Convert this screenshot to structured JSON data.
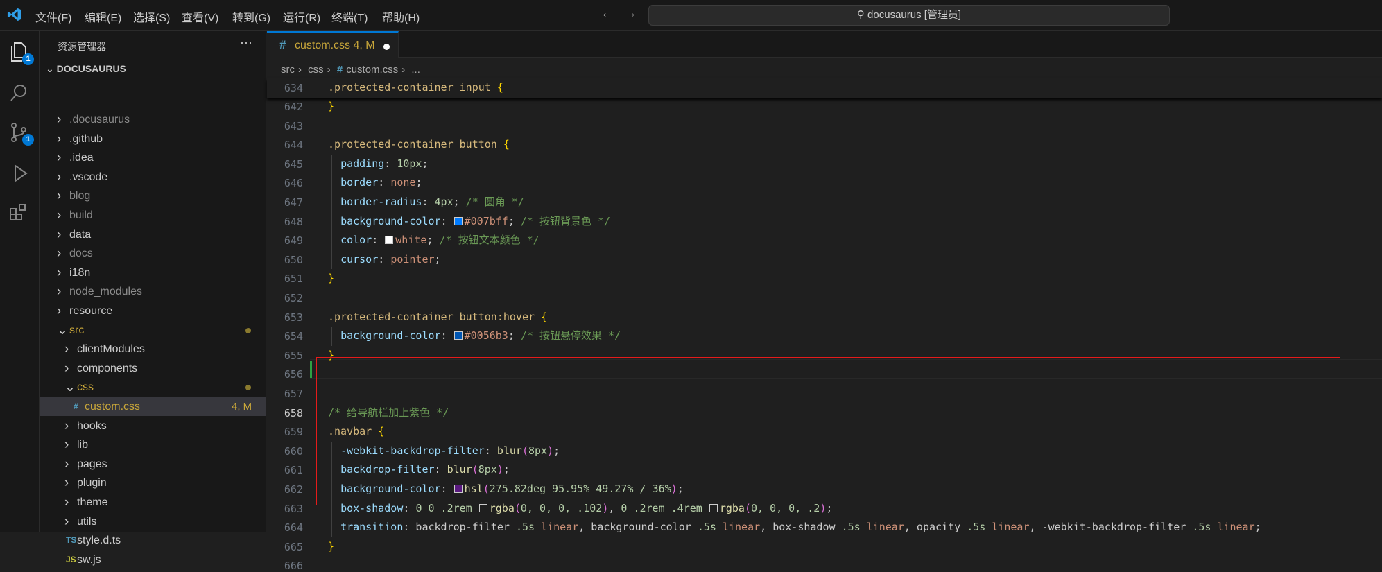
{
  "menu": [
    "文件(F)",
    "编辑(E)",
    "选择(S)",
    "查看(V)",
    "转到(G)",
    "运行(R)",
    "终端(T)",
    "帮助(H)"
  ],
  "command_center": "docusaurus [管理员]",
  "activity": {
    "explorer_badge": "1",
    "scm_badge": "1"
  },
  "sidebar": {
    "title": "资源管理器",
    "more": "···",
    "root": "DOCUSAURUS",
    "items": [
      {
        "label": ".docusaurus",
        "type": "folder",
        "depth": 0,
        "dim": true
      },
      {
        "label": ".github",
        "type": "folder",
        "depth": 0
      },
      {
        "label": ".idea",
        "type": "folder",
        "depth": 0
      },
      {
        "label": ".vscode",
        "type": "folder",
        "depth": 0
      },
      {
        "label": "blog",
        "type": "folder",
        "depth": 0,
        "dim": true
      },
      {
        "label": "build",
        "type": "folder",
        "depth": 0,
        "dim": true
      },
      {
        "label": "data",
        "type": "folder",
        "depth": 0
      },
      {
        "label": "docs",
        "type": "folder",
        "depth": 0,
        "dim": true
      },
      {
        "label": "i18n",
        "type": "folder",
        "depth": 0
      },
      {
        "label": "node_modules",
        "type": "folder",
        "depth": 0,
        "dim": true
      },
      {
        "label": "resource",
        "type": "folder",
        "depth": 0
      },
      {
        "label": "src",
        "type": "folder",
        "depth": 0,
        "open": true,
        "modified": true
      },
      {
        "label": "clientModules",
        "type": "folder",
        "depth": 1
      },
      {
        "label": "components",
        "type": "folder",
        "depth": 1
      },
      {
        "label": "css",
        "type": "folder",
        "depth": 1,
        "open": true,
        "modified": true
      },
      {
        "label": "custom.css",
        "type": "css",
        "depth": 2,
        "modified": true,
        "status": "4, M",
        "selected": true
      },
      {
        "label": "hooks",
        "type": "folder",
        "depth": 1
      },
      {
        "label": "lib",
        "type": "folder",
        "depth": 1
      },
      {
        "label": "pages",
        "type": "folder",
        "depth": 1
      },
      {
        "label": "plugin",
        "type": "folder",
        "depth": 1
      },
      {
        "label": "theme",
        "type": "folder",
        "depth": 1
      },
      {
        "label": "utils",
        "type": "folder",
        "depth": 1
      },
      {
        "label": "style.d.ts",
        "type": "ts",
        "depth": 1
      },
      {
        "label": "sw.js",
        "type": "js",
        "depth": 1
      }
    ]
  },
  "tab": {
    "name": "custom.css",
    "status": "4, M"
  },
  "breadcrumb": [
    "src",
    "css",
    "custom.css",
    "..."
  ],
  "colors": {
    "accent": "#0078d4",
    "highlight_box": "#e51b1b",
    "modified": "#c9a73a"
  },
  "sticky": {
    "num": "634",
    "tokens": [
      [
        ".protected-container input ",
        "s"
      ],
      [
        "{",
        "b"
      ]
    ]
  },
  "lines": [
    {
      "num": "642",
      "tokens": [
        [
          "}",
          "b"
        ]
      ]
    },
    {
      "num": "643",
      "tokens": []
    },
    {
      "num": "644",
      "tokens": [
        [
          ".protected-container button ",
          "s"
        ],
        [
          "{",
          "b"
        ]
      ]
    },
    {
      "num": "645",
      "tokens": [
        [
          "  ",
          "t"
        ],
        [
          "padding",
          "p"
        ],
        [
          ": ",
          "t"
        ],
        [
          "10px",
          "n"
        ],
        [
          ";",
          "t"
        ]
      ]
    },
    {
      "num": "646",
      "tokens": [
        [
          "  ",
          "t"
        ],
        [
          "border",
          "p"
        ],
        [
          ": ",
          "t"
        ],
        [
          "none",
          "v"
        ],
        [
          ";",
          "t"
        ]
      ]
    },
    {
      "num": "647",
      "tokens": [
        [
          "  ",
          "t"
        ],
        [
          "border-radius",
          "p"
        ],
        [
          ": ",
          "t"
        ],
        [
          "4px",
          "n"
        ],
        [
          "; ",
          "t"
        ],
        [
          "/* 圆角 */",
          "c"
        ]
      ]
    },
    {
      "num": "648",
      "tokens": [
        [
          "  ",
          "t"
        ],
        [
          "background-color",
          "p"
        ],
        [
          ": ",
          "t"
        ],
        [
          "#007bff",
          "sw"
        ],
        [
          "#007bff",
          "v"
        ],
        [
          "; ",
          "t"
        ],
        [
          "/* 按钮背景色 */",
          "c"
        ]
      ]
    },
    {
      "num": "649",
      "tokens": [
        [
          "  ",
          "t"
        ],
        [
          "color",
          "p"
        ],
        [
          ": ",
          "t"
        ],
        [
          "#ffffff",
          "sw"
        ],
        [
          "white",
          "v"
        ],
        [
          "; ",
          "t"
        ],
        [
          "/* 按钮文本颜色 */",
          "c"
        ]
      ]
    },
    {
      "num": "650",
      "tokens": [
        [
          "  ",
          "t"
        ],
        [
          "cursor",
          "p"
        ],
        [
          ": ",
          "t"
        ],
        [
          "pointer",
          "v"
        ],
        [
          ";",
          "t"
        ]
      ]
    },
    {
      "num": "651",
      "tokens": [
        [
          "}",
          "b"
        ]
      ]
    },
    {
      "num": "652",
      "tokens": []
    },
    {
      "num": "653",
      "tokens": [
        [
          ".protected-container button:hover ",
          "s"
        ],
        [
          "{",
          "b"
        ]
      ]
    },
    {
      "num": "654",
      "tokens": [
        [
          "  ",
          "t"
        ],
        [
          "background-color",
          "p"
        ],
        [
          ": ",
          "t"
        ],
        [
          "#0056b3",
          "sw"
        ],
        [
          "#0056b3",
          "v"
        ],
        [
          "; ",
          "t"
        ],
        [
          "/* 按钮悬停效果 */",
          "c"
        ]
      ]
    },
    {
      "num": "655",
      "tokens": [
        [
          "}",
          "b"
        ]
      ]
    },
    {
      "num": "656",
      "tokens": []
    },
    {
      "num": "657",
      "tokens": []
    },
    {
      "num": "658",
      "tokens": [
        [
          "/* 给导航栏加上紫色 */",
          "c"
        ]
      ]
    },
    {
      "num": "659",
      "tokens": [
        [
          ".navbar ",
          "s"
        ],
        [
          "{",
          "b"
        ]
      ]
    },
    {
      "num": "660",
      "tokens": [
        [
          "  ",
          "t"
        ],
        [
          "-webkit-backdrop-filter",
          "p"
        ],
        [
          ": ",
          "t"
        ],
        [
          "blur",
          "f"
        ],
        [
          "(",
          "q"
        ],
        [
          "8px",
          "n"
        ],
        [
          ")",
          "q"
        ],
        [
          ";",
          "t"
        ]
      ]
    },
    {
      "num": "661",
      "tokens": [
        [
          "  ",
          "t"
        ],
        [
          "backdrop-filter",
          "p"
        ],
        [
          ": ",
          "t"
        ],
        [
          "blur",
          "f"
        ],
        [
          "(",
          "q"
        ],
        [
          "8px",
          "n"
        ],
        [
          ")",
          "q"
        ],
        [
          ";",
          "t"
        ]
      ]
    },
    {
      "num": "662",
      "tokens": [
        [
          "  ",
          "t"
        ],
        [
          "background-color",
          "p"
        ],
        [
          ": ",
          "t"
        ],
        [
          "#5a1a80",
          "sw"
        ],
        [
          "hsl",
          "f"
        ],
        [
          "(",
          "q"
        ],
        [
          "275.82deg 95.95% 49.27% / 36%",
          "n"
        ],
        [
          ")",
          "q"
        ],
        [
          ";",
          "t"
        ]
      ]
    },
    {
      "num": "663",
      "tokens": [
        [
          "  ",
          "t"
        ],
        [
          "box-shadow",
          "p"
        ],
        [
          ": ",
          "t"
        ],
        [
          "0 0 .2rem ",
          "n"
        ],
        [
          "#1f1f1f",
          "sw"
        ],
        [
          "rgba",
          "f"
        ],
        [
          "(",
          "q"
        ],
        [
          "0, 0, 0, .102",
          "n"
        ],
        [
          ")",
          "q"
        ],
        [
          ", ",
          "t"
        ],
        [
          "0 .2rem .4rem ",
          "n"
        ],
        [
          "#1f1f1f",
          "sw"
        ],
        [
          "rgba",
          "f"
        ],
        [
          "(",
          "q"
        ],
        [
          "0, 0, 0, .2",
          "n"
        ],
        [
          ")",
          "q"
        ],
        [
          ";",
          "t"
        ]
      ]
    },
    {
      "num": "664",
      "tokens": [
        [
          "  ",
          "t"
        ],
        [
          "transition",
          "p"
        ],
        [
          ": backdrop-filter ",
          "t"
        ],
        [
          ".5s ",
          "n"
        ],
        [
          "linear",
          "v"
        ],
        [
          ", background-color ",
          "t"
        ],
        [
          ".5s ",
          "n"
        ],
        [
          "linear",
          "v"
        ],
        [
          ", box-shadow ",
          "t"
        ],
        [
          ".5s ",
          "n"
        ],
        [
          "linear",
          "v"
        ],
        [
          ", opacity ",
          "t"
        ],
        [
          ".5s ",
          "n"
        ],
        [
          "linear",
          "v"
        ],
        [
          ", -webkit-backdrop-filter ",
          "t"
        ],
        [
          ".5s ",
          "n"
        ],
        [
          "linear",
          "v"
        ],
        [
          ";",
          "t"
        ]
      ]
    },
    {
      "num": "665",
      "tokens": [
        [
          "}",
          "b"
        ]
      ]
    },
    {
      "num": "666",
      "tokens": []
    }
  ]
}
